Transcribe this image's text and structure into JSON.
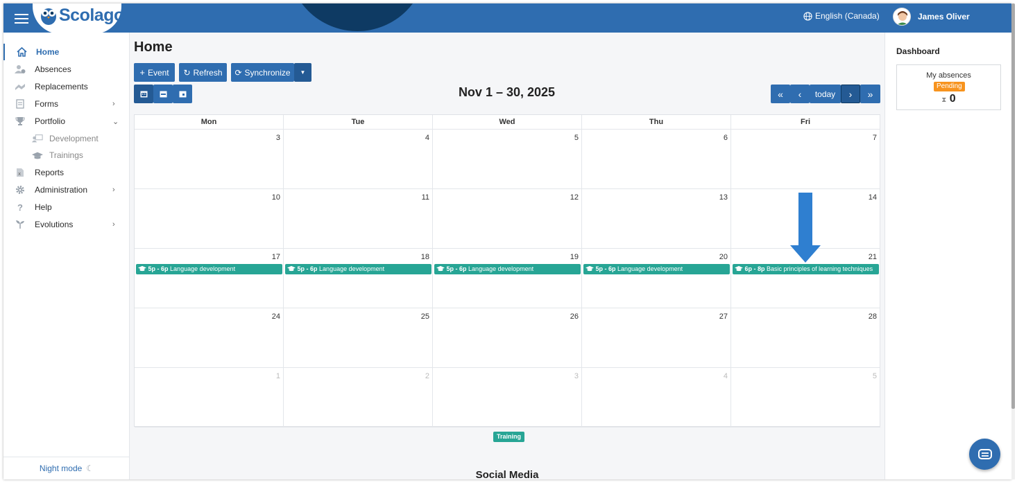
{
  "app": {
    "logo_text": "Scolago"
  },
  "header": {
    "language": "English (Canada)",
    "user_name": "James Oliver"
  },
  "sidebar": {
    "items": [
      {
        "label": "Home",
        "icon": "home-icon",
        "active": true
      },
      {
        "label": "Absences",
        "icon": "absence-icon"
      },
      {
        "label": "Replacements",
        "icon": "replacements-icon"
      },
      {
        "label": "Forms",
        "icon": "forms-icon",
        "chevron": "›"
      },
      {
        "label": "Portfolio",
        "icon": "trophy-icon",
        "chevron": "⌄"
      },
      {
        "label": "Development",
        "icon": "development-icon",
        "sub": true
      },
      {
        "label": "Trainings",
        "icon": "graduation-cap-icon",
        "sub": true
      },
      {
        "label": "Reports",
        "icon": "reports-icon"
      },
      {
        "label": "Administration",
        "icon": "gear-icon",
        "chevron": "›"
      },
      {
        "label": "Help",
        "icon": "question-icon"
      },
      {
        "label": "Evolutions",
        "icon": "sprout-icon",
        "chevron": "›"
      }
    ],
    "night_mode": "Night mode"
  },
  "main": {
    "title": "Home",
    "toolbar": {
      "event": "Event",
      "refresh": "Refresh",
      "synchronize": "Synchronize"
    },
    "nav": {
      "today": "today"
    },
    "calendar_title": "Nov 1 – 30, 2025",
    "weekdays": [
      "Mon",
      "Tue",
      "Wed",
      "Thu",
      "Fri"
    ],
    "weeks": [
      [
        {
          "d": "3"
        },
        {
          "d": "4"
        },
        {
          "d": "5"
        },
        {
          "d": "6"
        },
        {
          "d": "7"
        }
      ],
      [
        {
          "d": "10"
        },
        {
          "d": "11"
        },
        {
          "d": "12"
        },
        {
          "d": "13"
        },
        {
          "d": "14"
        }
      ],
      [
        {
          "d": "17"
        },
        {
          "d": "18"
        },
        {
          "d": "19"
        },
        {
          "d": "20"
        },
        {
          "d": "21"
        }
      ],
      [
        {
          "d": "24"
        },
        {
          "d": "25"
        },
        {
          "d": "26"
        },
        {
          "d": "27"
        },
        {
          "d": "28"
        }
      ],
      [
        {
          "d": "1",
          "other": true
        },
        {
          "d": "2",
          "other": true
        },
        {
          "d": "3",
          "other": true
        },
        {
          "d": "4",
          "other": true
        },
        {
          "d": "5",
          "other": true
        }
      ]
    ],
    "events": [
      {
        "week": 2,
        "day": 0,
        "time": "5p - 6p",
        "title": "Language development"
      },
      {
        "week": 2,
        "day": 1,
        "time": "5p - 6p",
        "title": "Language development"
      },
      {
        "week": 2,
        "day": 2,
        "time": "5p - 6p",
        "title": "Language development"
      },
      {
        "week": 2,
        "day": 3,
        "time": "5p - 6p",
        "title": "Language development"
      },
      {
        "week": 2,
        "day": 4,
        "time": "6p - 8p",
        "title": "Basic principles of learning techniques"
      }
    ],
    "legend": "Training",
    "social_title": "Social Media"
  },
  "dashboard": {
    "title": "Dashboard",
    "absences_label": "My absences",
    "status": "Pending",
    "count": "0"
  },
  "colors": {
    "primary": "#2f6db0",
    "event": "#27a595",
    "pending": "#f7931e",
    "header_dark": "#0e3a63"
  }
}
